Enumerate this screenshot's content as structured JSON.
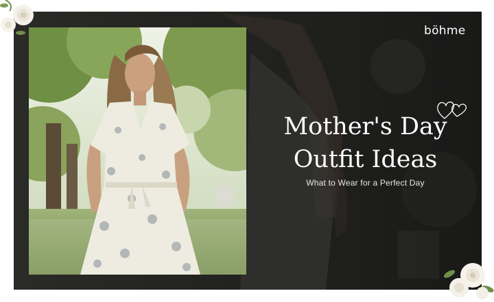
{
  "brand": {
    "name": "böhme"
  },
  "headline": {
    "line1": "Mother's Day",
    "line2": "Outfit Ideas"
  },
  "subheadline": "What to Wear for a Perfect Day",
  "colors": {
    "panel": "#1c1c1b",
    "text": "#ffffff",
    "page": "#ffffff"
  },
  "icons": [
    "heart-outline-icon",
    "white-flower-decoration"
  ]
}
